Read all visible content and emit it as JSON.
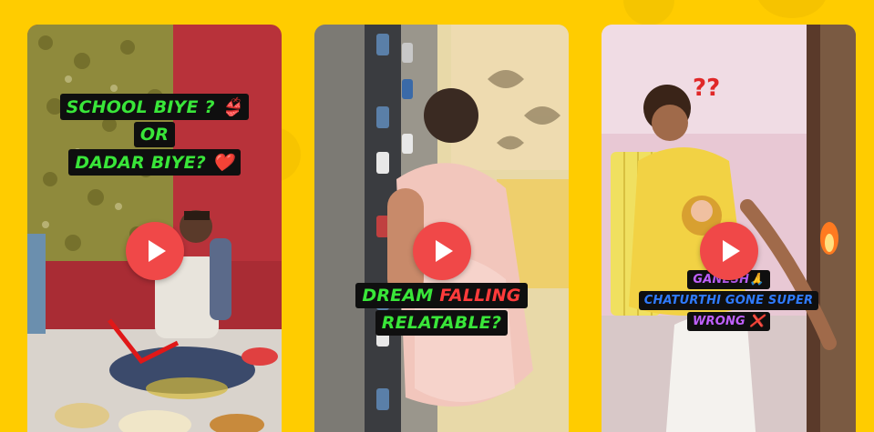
{
  "cards": [
    {
      "caption_lines": [
        "SCHOOL BIYE ? 👙",
        "OR",
        "DADAR BIYE? ❤️"
      ],
      "play_label": "Play video"
    },
    {
      "caption_line1": [
        "DREAM ",
        "FALLING"
      ],
      "caption_line2": "RELATABLE?",
      "play_label": "Play video"
    },
    {
      "caption_lines": [
        "GANESH🙏",
        "CHATURTHI GONE SUPER",
        "WRONG ❌"
      ],
      "sticker_text": "??",
      "play_label": "Play video"
    }
  ],
  "colors": {
    "background": "#ffcc00",
    "play_button": "#f04848",
    "caption_green": "#39e639",
    "caption_red": "#ff3b3b",
    "caption_blue": "#2f7bff",
    "caption_purple": "#c060ff"
  },
  "icons": [
    "play-icon"
  ]
}
